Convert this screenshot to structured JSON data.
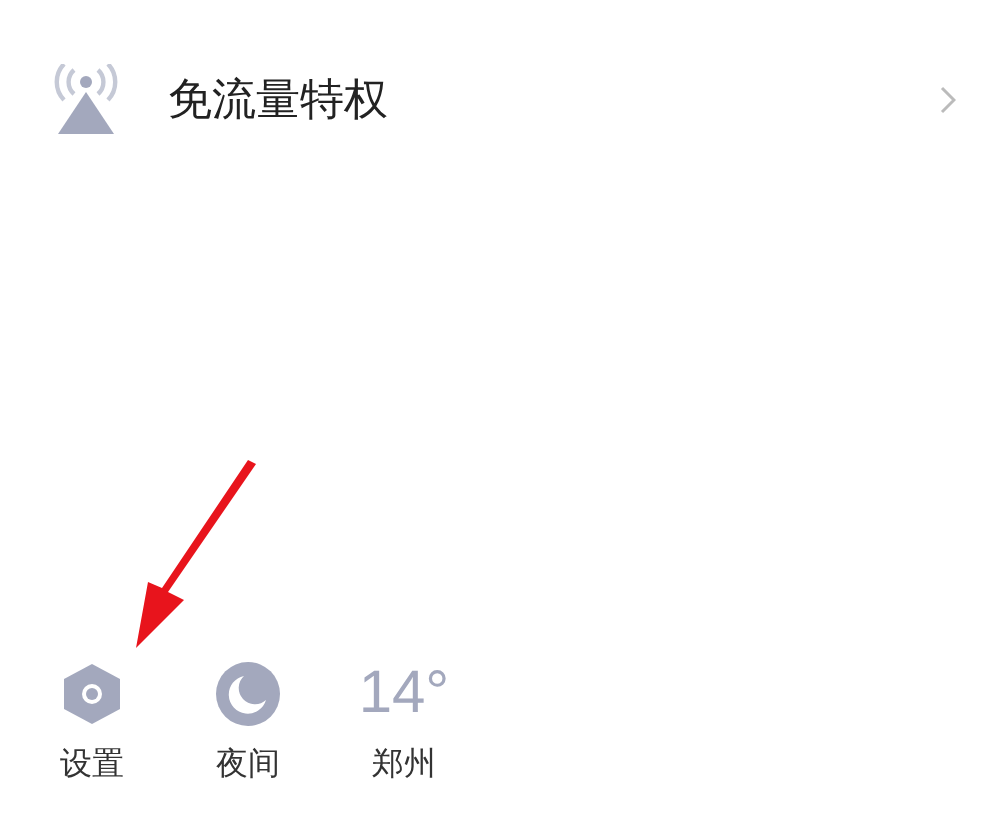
{
  "menu_row": {
    "label": "免流量特权"
  },
  "bottom_items": [
    {
      "kind": "settings",
      "label": "设置"
    },
    {
      "kind": "night",
      "label": "夜间"
    },
    {
      "kind": "weather",
      "value": "14°",
      "label": "郑州"
    }
  ]
}
